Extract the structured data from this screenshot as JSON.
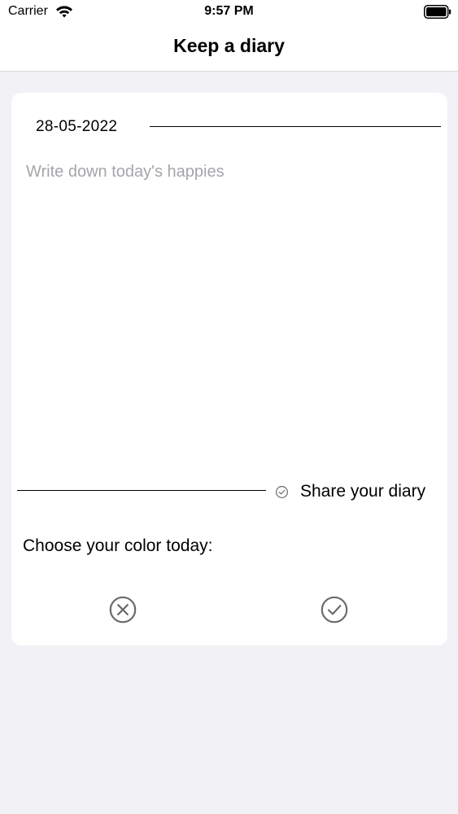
{
  "status_bar": {
    "carrier": "Carrier",
    "time": "9:57 PM",
    "icons": [
      "wifi-icon",
      "battery-icon"
    ]
  },
  "nav": {
    "title": "Keep a diary"
  },
  "diary": {
    "date": "28-05-2022",
    "entry_value": "",
    "entry_placeholder": "Write down today's happies",
    "share_label": "Share your diary",
    "share_icon": "check-circle-icon",
    "color_prompt": "Choose your color today:",
    "cancel_icon": "x-circle-icon",
    "confirm_icon": "check-circle-icon"
  },
  "colors": {
    "background": "#f2f1f6",
    "card": "#ffffff",
    "placeholder": "#a5a5aa",
    "icon_gray": "#6b6b6e"
  }
}
